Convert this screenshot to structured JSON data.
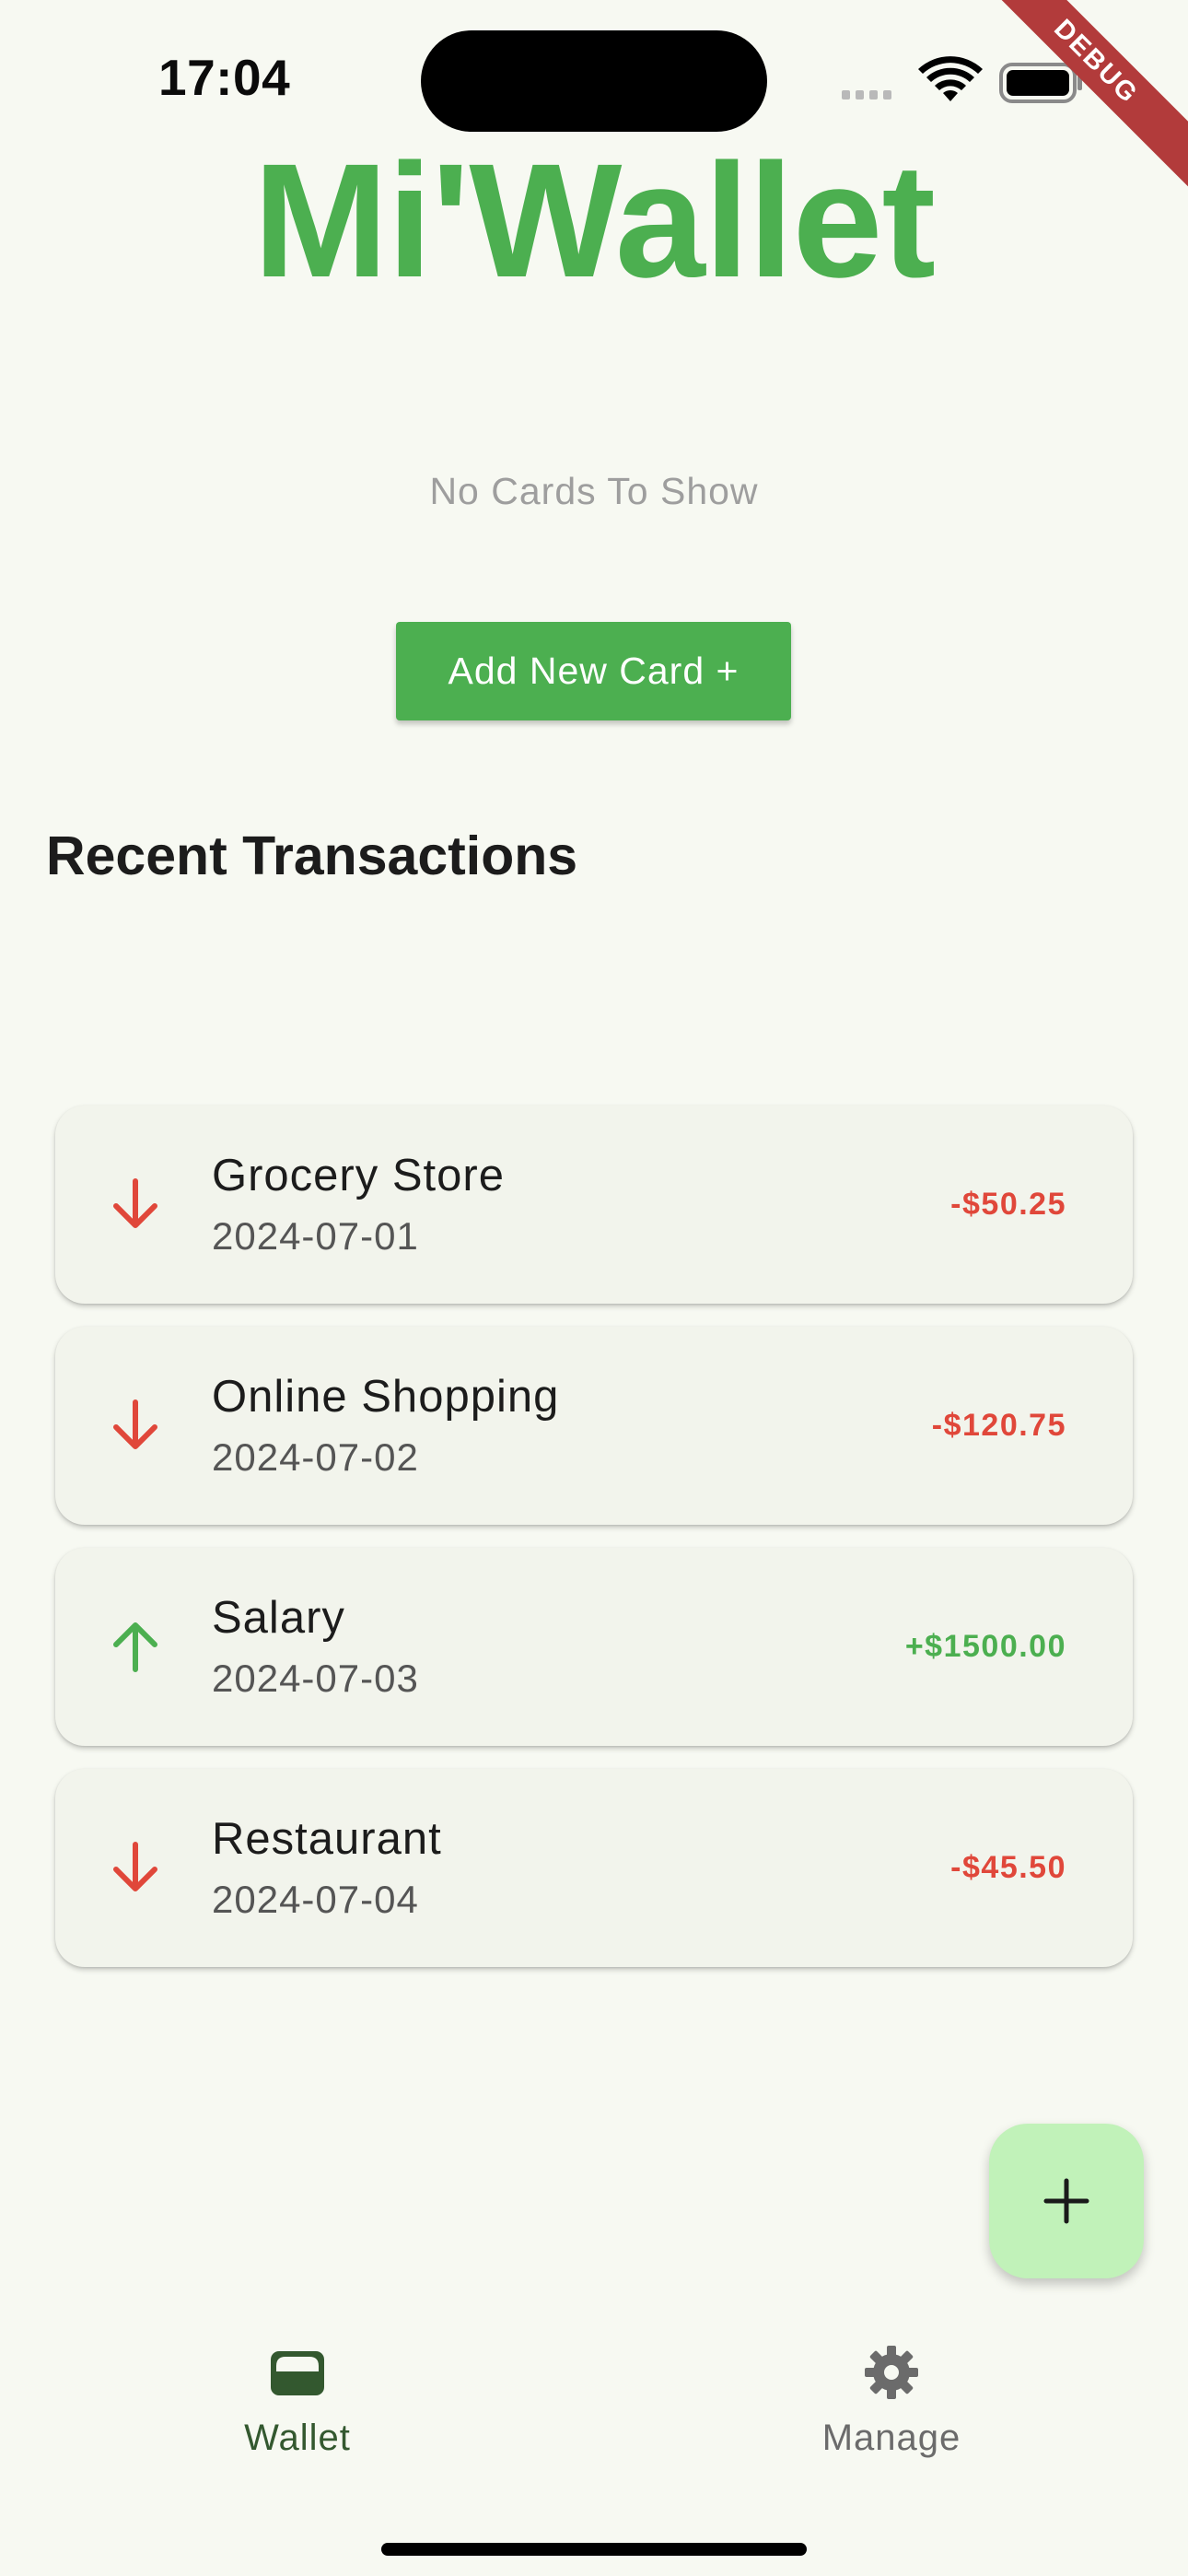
{
  "status_bar": {
    "time": "17:04"
  },
  "debug_banner": "DEBUG",
  "app": {
    "title": "Mi'Wallet"
  },
  "cards": {
    "empty_message": "No Cards To Show",
    "add_button_label": "Add New Card +"
  },
  "transactions": {
    "section_title": "Recent Transactions",
    "items": [
      {
        "name": "Grocery Store",
        "date": "2024-07-01",
        "amount": "-$50.25",
        "direction": "down",
        "icon": "arrow-down-icon"
      },
      {
        "name": "Online Shopping",
        "date": "2024-07-02",
        "amount": "-$120.75",
        "direction": "down",
        "icon": "arrow-down-icon"
      },
      {
        "name": "Salary",
        "date": "2024-07-03",
        "amount": "+$1500.00",
        "direction": "up",
        "icon": "arrow-up-icon"
      },
      {
        "name": "Restaurant",
        "date": "2024-07-04",
        "amount": "-$45.50",
        "direction": "down",
        "icon": "arrow-down-icon"
      }
    ]
  },
  "fab": {
    "label": "+",
    "icon": "plus-icon"
  },
  "bottom_nav": {
    "items": [
      {
        "label": "Wallet",
        "icon": "wallet-icon",
        "active": true
      },
      {
        "label": "Manage",
        "icon": "gear-icon",
        "active": false
      }
    ]
  },
  "colors": {
    "background": "#f7f9f2",
    "brand_green": "#4caf50",
    "expense_red": "#e0473a",
    "income_green": "#4caf50",
    "card_bg": "#f2f4ec",
    "fab_bg": "#c1f2b9",
    "nav_active": "#33582f",
    "nav_inactive": "#6b6b6b",
    "muted_text": "#9e9e9e"
  }
}
